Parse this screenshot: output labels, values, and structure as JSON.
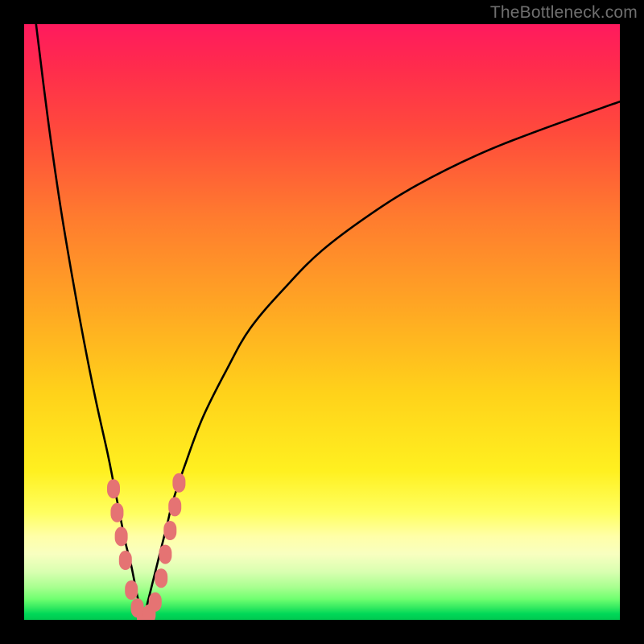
{
  "watermark": "TheBottleneck.com",
  "colors": {
    "frame": "#000000",
    "curve": "#000000",
    "marker_fill": "#e57373",
    "marker_stroke": "#b85a5a"
  },
  "chart_data": {
    "type": "line",
    "title": "",
    "xlabel": "",
    "ylabel": "",
    "xlim": [
      0,
      100
    ],
    "ylim": [
      0,
      100
    ],
    "grid": false,
    "legend": false,
    "note": "Bottleneck-style V-curve. Y is implied % bottleneck (red=high, green=low). X is an implicit component scale. Minimum ≈ x=20.",
    "series": [
      {
        "name": "left-branch",
        "x": [
          2,
          4,
          6,
          8,
          10,
          12,
          14,
          15,
          16,
          17,
          18,
          19,
          20
        ],
        "y": [
          100,
          84,
          70,
          58,
          47,
          37,
          28,
          23,
          18,
          13,
          9,
          4,
          0
        ]
      },
      {
        "name": "right-branch",
        "x": [
          20,
          21,
          22,
          23,
          24,
          25,
          27,
          30,
          34,
          38,
          44,
          50,
          58,
          66,
          76,
          86,
          100
        ],
        "y": [
          0,
          4,
          8,
          12,
          16,
          20,
          26,
          34,
          42,
          49,
          56,
          62,
          68,
          73,
          78,
          82,
          87
        ]
      }
    ],
    "markers": {
      "name": "highlighted-cluster",
      "shape": "pill",
      "points": [
        {
          "x": 15.0,
          "y": 22
        },
        {
          "x": 15.6,
          "y": 18
        },
        {
          "x": 16.3,
          "y": 14
        },
        {
          "x": 17.0,
          "y": 10
        },
        {
          "x": 18.0,
          "y": 5
        },
        {
          "x": 19.0,
          "y": 2
        },
        {
          "x": 20.0,
          "y": 0.5
        },
        {
          "x": 21.0,
          "y": 1
        },
        {
          "x": 22.0,
          "y": 3
        },
        {
          "x": 23.0,
          "y": 7
        },
        {
          "x": 23.7,
          "y": 11
        },
        {
          "x": 24.5,
          "y": 15
        },
        {
          "x": 25.3,
          "y": 19
        },
        {
          "x": 26.0,
          "y": 23
        }
      ]
    }
  }
}
